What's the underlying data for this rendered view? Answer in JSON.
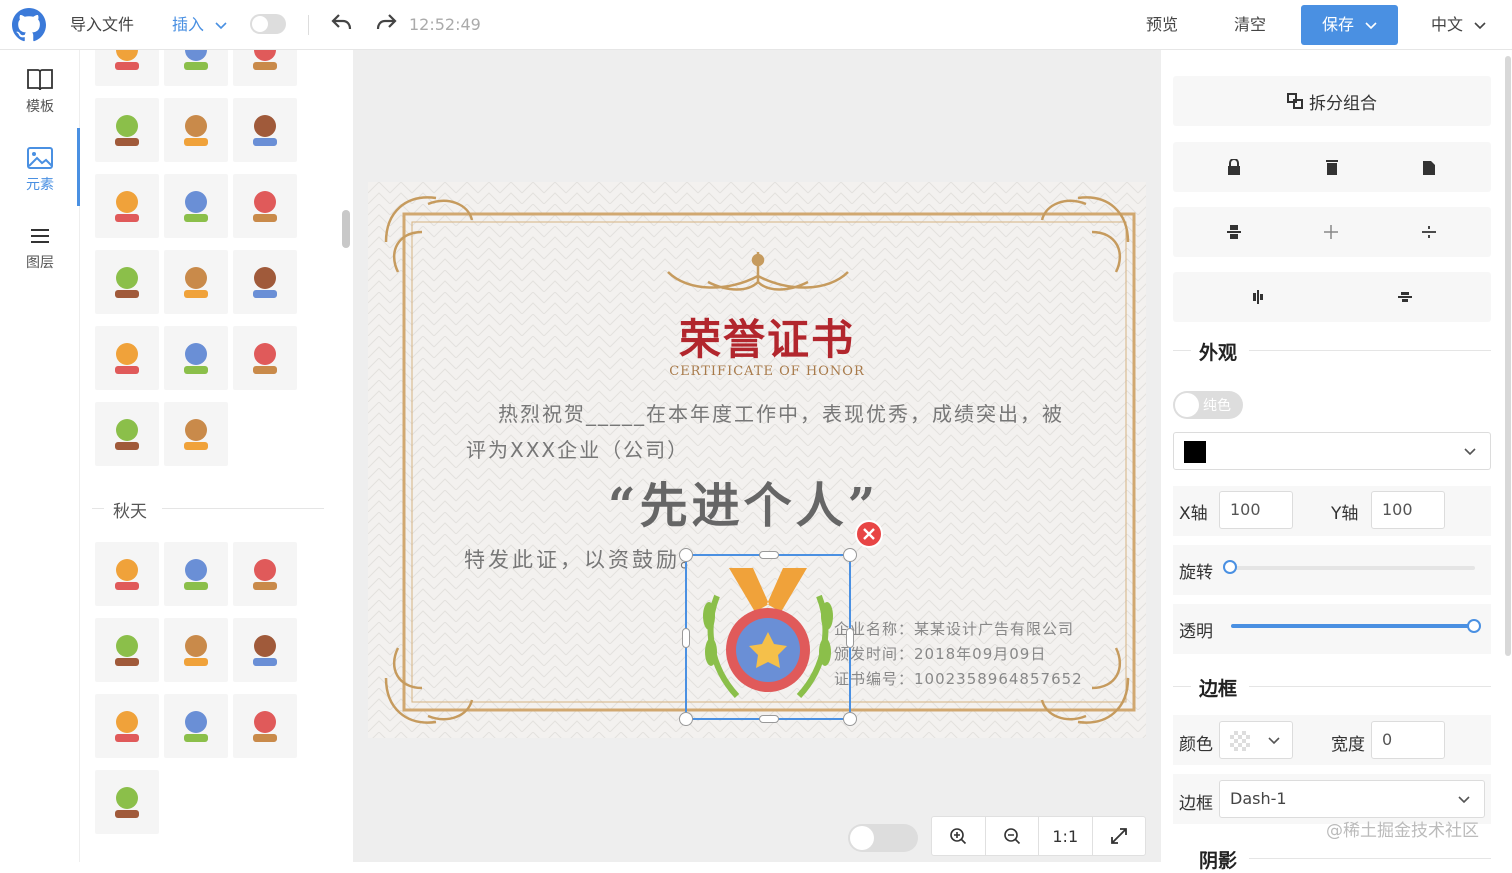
{
  "topbar": {
    "import_label": "导入文件",
    "insert_label": "插入",
    "time": "12:52:49",
    "preview_label": "预览",
    "clear_label": "清空",
    "save_label": "保存",
    "lang_label": "中文"
  },
  "rail": {
    "items": [
      {
        "label": "模板",
        "icon": "book-icon"
      },
      {
        "label": "元素",
        "icon": "image-icon"
      },
      {
        "label": "图层",
        "icon": "layers-icon"
      }
    ],
    "active": "元素"
  },
  "panel": {
    "autumn_title": "秋天"
  },
  "certificate": {
    "title": "荣誉证书",
    "subtitle": "CERTIFICATE OF HONOR",
    "line1": "热烈祝贺_____在本年度工作中，表现优秀，成绩突出，被",
    "line2": "评为XXX企业（公司）",
    "award": "“先进个人”",
    "line3": "特发此证，以资鼓励。",
    "company": "企业名称：某某设计广告有限公司",
    "date": "颁发时间：2018年09月09日",
    "number": "证书编号：1002358964857652"
  },
  "zoom": {
    "zoom_in": "zoom-in-icon",
    "zoom_out": "zoom-out-icon",
    "reset": "1:1",
    "fullscreen": "expand-icon"
  },
  "right": {
    "ungroup_label": "拆分组合",
    "appearance_title": "外观",
    "solid_label": "纯色",
    "fill_color": "#000000",
    "x_label": "X轴",
    "x_value": "100",
    "y_label": "Y轴",
    "y_value": "100",
    "rotate_label": "旋转",
    "rotate_value": 0,
    "opacity_label": "透明",
    "opacity_value": 1,
    "border_title": "边框",
    "color_label": "颜色",
    "width_label": "宽度",
    "width_value": "0",
    "border_style_label": "边框",
    "border_style_value": "Dash-1",
    "shadow_title": "阴影"
  },
  "watermark": "@稀土掘金技术社区",
  "colors": {
    "accent": "#4a90e2",
    "title_red": "#b2262d",
    "gold": "#c9a46a",
    "selection": "#4a90e2"
  }
}
